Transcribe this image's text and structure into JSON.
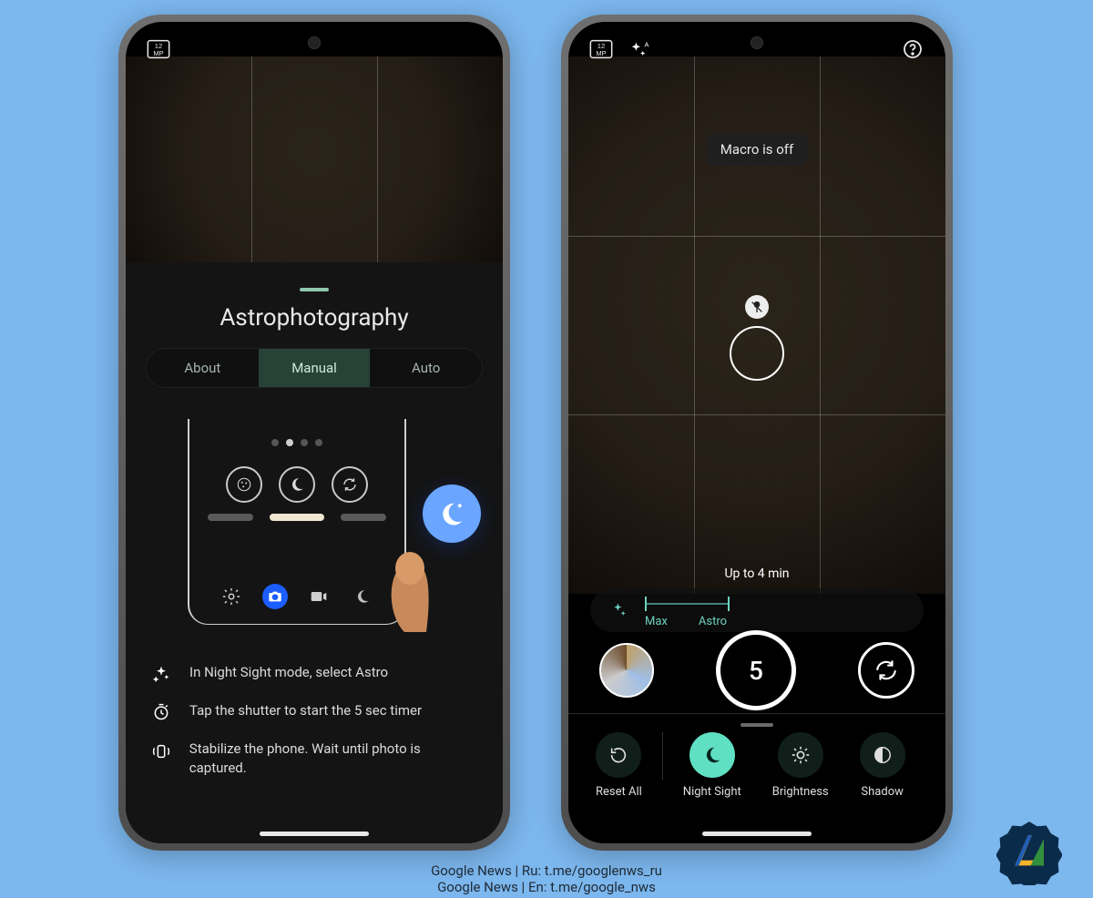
{
  "background_color": "#7cb7ee",
  "left_phone": {
    "statusbar": {
      "mp_label": "12 MP"
    },
    "sheet": {
      "title": "Astrophotography",
      "tabs": {
        "about": "About",
        "manual": "Manual",
        "auto": "Auto",
        "active": "manual"
      },
      "tips": {
        "t1": "In Night Sight mode, select Astro",
        "t2": "Tap the shutter to start the 5 sec timer",
        "t3": "Stabilize the phone. Wait until photo is captured."
      }
    }
  },
  "right_phone": {
    "statusbar": {
      "mp_label": "12 MP"
    },
    "toast": "Macro is off",
    "exposure_hint": "Up to 4 min",
    "slider": {
      "label_max": "Max",
      "label_astro": "Astro"
    },
    "shutter_count": "5",
    "shelf": {
      "reset": "Reset All",
      "night": "Night Sight",
      "brightness": "Brightness",
      "shadow": "Shadow"
    }
  },
  "caption": {
    "line1": "Google News | Ru: t.me/googlenws_ru",
    "line2": "Google News | En: t.me/google_nws"
  }
}
